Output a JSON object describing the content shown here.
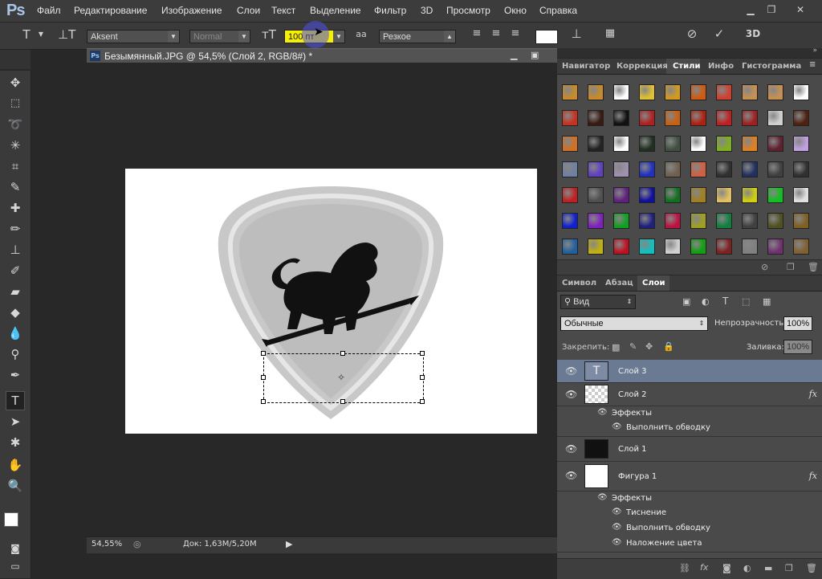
{
  "app": {
    "logo": "Ps"
  },
  "menu": [
    "Файл",
    "Редактирование",
    "Изображение",
    "Слои",
    "Текст",
    "Выделение",
    "Фильтр",
    "3D",
    "Просмотр",
    "Окно",
    "Справка"
  ],
  "options": {
    "font_family": "Aksent",
    "font_style": "Normal",
    "font_size": "100 пт",
    "aa_label": "aa",
    "antialias": "Резкое",
    "color": "#ffffff"
  },
  "document": {
    "title": "Безымянный.JPG @ 54,5% (Слой 2, RGB/8#) *",
    "zoom": "54,55%",
    "doc_info": "Док: 1,63M/5,20M"
  },
  "styles_panel": {
    "tabs": [
      "Навигатор",
      "Коррекция",
      "Стили",
      "Инфо",
      "Гистограмма"
    ],
    "active_tab": "Стили",
    "swatch_colors": [
      [
        "#c98a2a",
        "#c98a2a",
        "#ffffff",
        "#e0c030",
        "#d49a20",
        "#d05a10",
        "#d04030",
        "#c89050",
        "#c89050",
        "#ffffff"
      ],
      [
        "#c83020",
        "#3a1a10",
        "#111111",
        "#b02020",
        "#c86010",
        "#b02010",
        "#c02020",
        "#a02020",
        "#d0d0d0",
        "#502010"
      ],
      [
        "#d07020",
        "#222222",
        "#ffffff",
        "#203020",
        "#405040",
        "#ffffff",
        "#80b020",
        "#e08020",
        "#602030",
        "#c0a0e0"
      ],
      [
        "#7080a0",
        "#6040c0",
        "#a090b0",
        "#2030c0",
        "#706050",
        "#d06040",
        "#303030",
        "#203060",
        "#404040",
        "#303030"
      ],
      [
        "#c02020",
        "#505050",
        "#602080",
        "#1010a0",
        "#107020",
        "#a08020",
        "#e0c060",
        "#d0d010",
        "#10c020",
        "#e0e0e0"
      ],
      [
        "#1020d0",
        "#8020c0",
        "#10a020",
        "#202080",
        "#c01040",
        "#a0a020",
        "#108040",
        "#404040",
        "#505020",
        "#806020"
      ],
      [
        "#2060a0",
        "#c0b010",
        "#c01020",
        "#10c0c0",
        "#d0d0d0",
        "#10a010",
        "#802020",
        "#808080",
        "#703070",
        "#806030"
      ]
    ]
  },
  "layers_panel": {
    "tabs": [
      "Символ",
      "Абзац",
      "Слои"
    ],
    "active_tab": "Слои",
    "filter": "Вид",
    "blend_mode": "Обычные",
    "opacity_label": "Непрозрачность:",
    "opacity": "100%",
    "lock_label": "Закрепить:",
    "fill_label": "Заливка:",
    "fill": "100%",
    "layers": [
      {
        "name": "Слой 3",
        "fx": "",
        "effects_label": "",
        "effects": []
      },
      {
        "name": "Слой 2",
        "fx": "fx",
        "effects_label": "Эффекты",
        "effects": [
          "Выполнить обводку"
        ]
      },
      {
        "name": "Слой 1",
        "fx": "",
        "effects_label": "",
        "effects": []
      },
      {
        "name": "Фигура 1",
        "fx": "fx",
        "effects_label": "Эффекты",
        "effects": [
          "Тиснение",
          "Выполнить обводку",
          "Наложение цвета"
        ]
      }
    ]
  }
}
